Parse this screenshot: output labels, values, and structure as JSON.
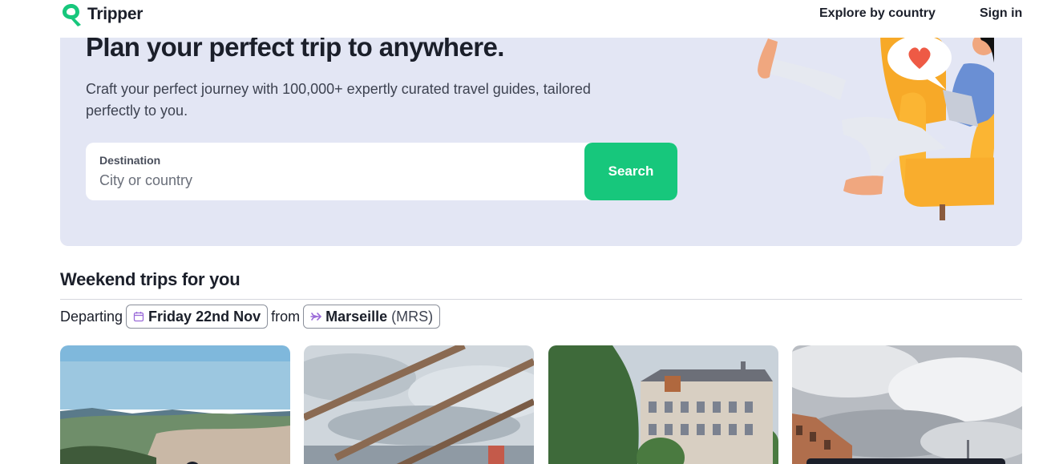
{
  "header": {
    "brand": "Tripper",
    "nav": {
      "explore": "Explore by country",
      "signin": "Sign in"
    }
  },
  "hero": {
    "title": "Plan your perfect trip to anywhere.",
    "subtitle": "Craft your perfect journey with 100,000+ expertly curated travel guides, tailored perfectly to you.",
    "search": {
      "label": "Destination",
      "placeholder": "City or country",
      "button": "Search"
    }
  },
  "weekend": {
    "title": "Weekend trips for you",
    "departing_label": "Departing",
    "date": "Friday 22nd Nov",
    "from_label": "from",
    "city": "Marseille",
    "code": "(MRS)"
  },
  "colors": {
    "accent": "#17c77c",
    "hero_bg": "#e3e6f4",
    "text": "#1b1f2a"
  },
  "icons": {
    "logo": "tripper-logo-icon",
    "calendar": "calendar-icon",
    "plane": "plane-icon"
  }
}
